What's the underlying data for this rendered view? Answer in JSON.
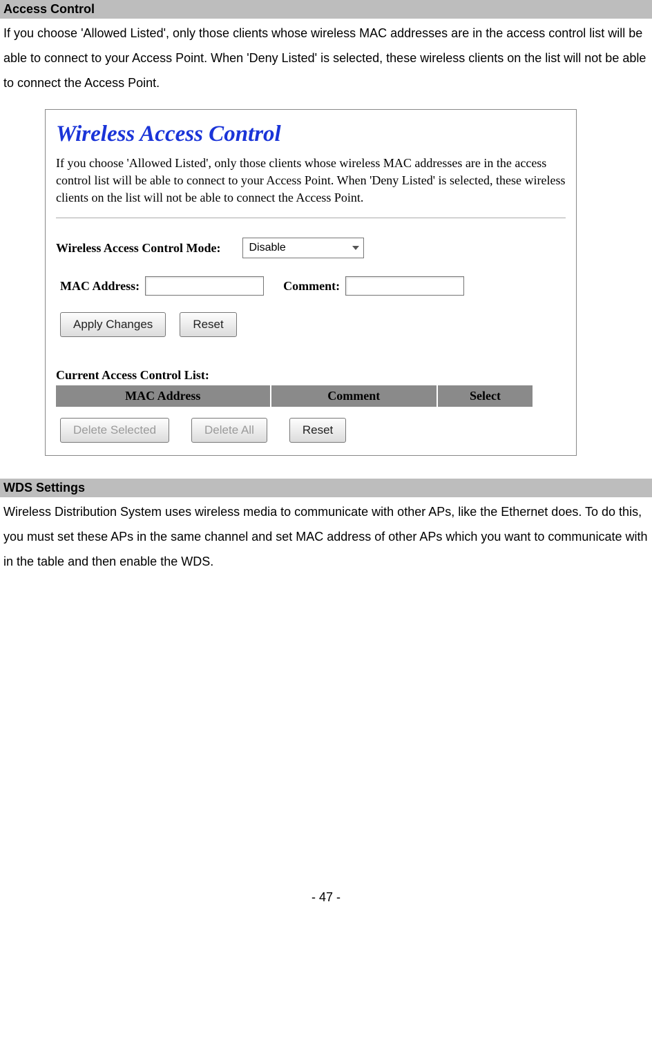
{
  "access_control": {
    "header": "Access Control",
    "paragraph": "If you choose 'Allowed Listed', only those clients whose wireless MAC addresses are in the access control list will be able to connect to your Access Point. When 'Deny Listed' is selected, these wireless clients on the list will not be able to connect the Access Point."
  },
  "wac_panel": {
    "title": "Wireless Access Control",
    "description": "If you choose 'Allowed Listed', only those clients whose wireless MAC addresses are in the access control list will be able to connect to your Access Point. When 'Deny Listed' is selected, these wireless clients on the list will not be able to connect the Access Point.",
    "mode_label": "Wireless Access Control Mode:",
    "mode_value": "Disable",
    "mac_label": "MAC Address:",
    "comment_label": "Comment:",
    "apply_btn": "Apply Changes",
    "reset_btn": "Reset",
    "list_label": "Current Access Control List:",
    "table_headers": {
      "col1": "MAC Address",
      "col2": "Comment",
      "col3": "Select"
    },
    "delete_selected_btn": "Delete Selected",
    "delete_all_btn": "Delete All",
    "reset2_btn": "Reset"
  },
  "wds_settings": {
    "header": "WDS Settings",
    "paragraph": "Wireless Distribution System uses wireless media to communicate with other APs, like the Ethernet does. To do this, you must set these APs in the same channel and set MAC address of other APs which you want to communicate with in the table and then enable the WDS."
  },
  "page_number": "- 47 -"
}
